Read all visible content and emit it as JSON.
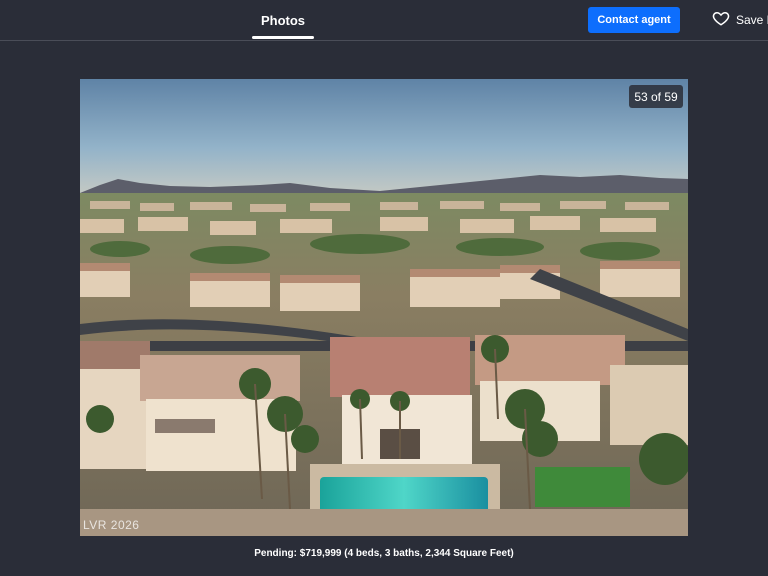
{
  "header": {
    "tabs": [
      {
        "label": "Photos",
        "active": true
      }
    ],
    "contact_label": "Contact agent",
    "save_label": "Save H",
    "accent_color": "#0d6efd"
  },
  "gallery": {
    "counter": "53 of 59",
    "current_index": 53,
    "total": 59,
    "watermark": "LVR 2026",
    "caption": "Pending: $719,999 (4 beds, 3 baths, 2,344 Square Feet)"
  },
  "icons": {
    "save": "heart-outline-icon"
  }
}
